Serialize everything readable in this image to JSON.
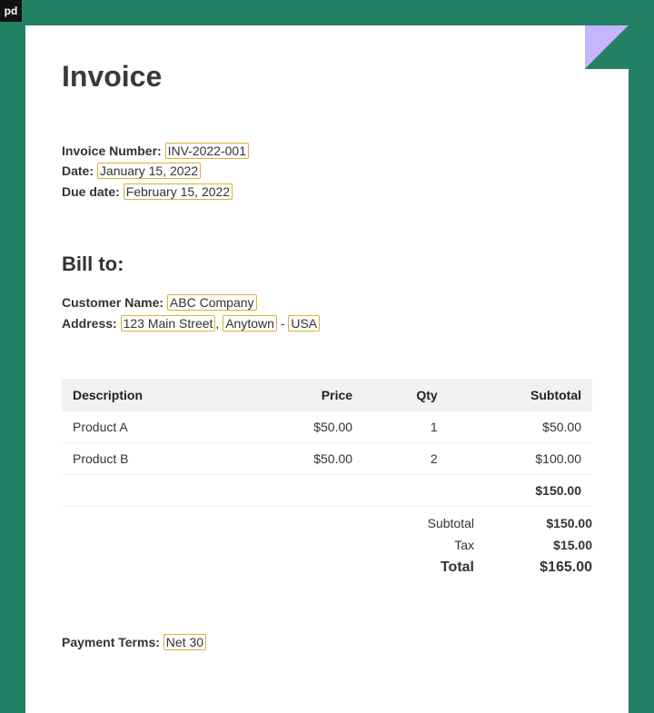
{
  "logo": "pd",
  "title": "Invoice",
  "meta": {
    "invoice_number_label": "Invoice Number:",
    "invoice_number": "INV-2022-001",
    "date_label": "Date:",
    "date": "January 15, 2022",
    "due_label": "Due date:",
    "due": "February 15,  2022"
  },
  "bill": {
    "heading": "Bill to:",
    "name_label": "Customer Name:",
    "name": "ABC Company",
    "address_label": "Address:",
    "street": "123 Main Street",
    "city": "Anytown",
    "country": "USA"
  },
  "table": {
    "headers": {
      "description": "Description",
      "price": "Price",
      "qty": "Qty",
      "subtotal": "Subtotal"
    },
    "rows": [
      {
        "description": "Product A",
        "price": "$50.00",
        "qty": "1",
        "subtotal": "$50.00"
      },
      {
        "description": "Product B",
        "price": "$50.00",
        "qty": "2",
        "subtotal": "$100.00"
      }
    ],
    "grand": "$150.00"
  },
  "summary": {
    "subtotal_label": "Subtotal",
    "subtotal": "$150.00",
    "tax_label": "Tax",
    "tax": "$15.00",
    "total_label": "Total",
    "total": "$165.00"
  },
  "terms": {
    "label": "Payment Terms:",
    "value": "Net 30"
  }
}
